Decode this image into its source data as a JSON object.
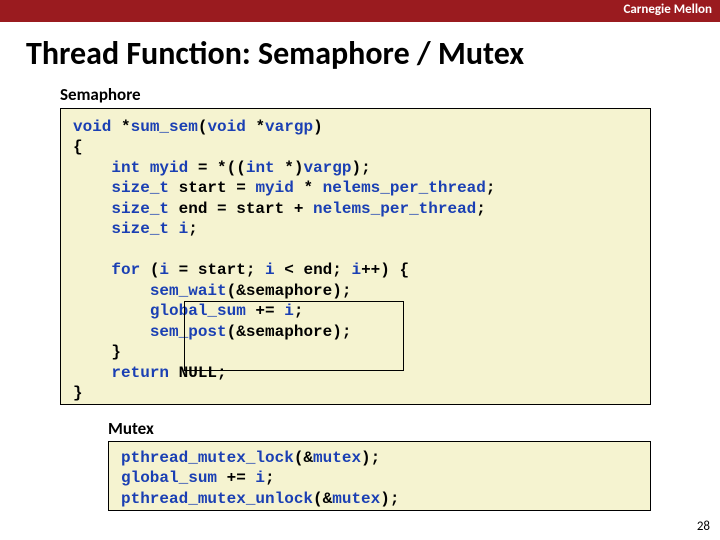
{
  "brand": "Carnegie Mellon",
  "title": "Thread Function: Semaphore / Mutex",
  "sem_label": "Semaphore",
  "mutex_label": "Mutex",
  "page_number": "28",
  "code1": {
    "l1a": "void",
    "l1b": " *",
    "l1c": "sum_sem",
    "l1d": "(",
    "l1e": "void",
    "l1f": " *",
    "l1g": "vargp",
    "l1h": ")",
    "l2": "{",
    "l3a": "    ",
    "l3b": "int",
    "l3c": " ",
    "l3d": "myid",
    "l3e": " = *((",
    "l3f": "int",
    "l3g": " *)",
    "l3h": "vargp",
    "l3i": ");",
    "l4a": "    ",
    "l4b": "size_t",
    "l4c": " start = ",
    "l4d": "myid",
    "l4e": " * ",
    "l4f": "nelems_per_thread",
    "l4g": ";",
    "l5a": "    ",
    "l5b": "size_t",
    "l5c": " end = start + ",
    "l5d": "nelems_per_thread",
    "l5e": ";",
    "l6a": "    ",
    "l6b": "size_t",
    "l6c": " ",
    "l6d": "i",
    "l6e": ";",
    "blank1": " ",
    "l7a": "    ",
    "l7b": "for",
    "l7c": " (",
    "l7d": "i",
    "l7e": " = start; ",
    "l7f": "i",
    "l7g": " < end; ",
    "l7h": "i",
    "l7i": "++) {",
    "l8a": "        ",
    "l8b": "sem_wait",
    "l8c": "(&semaphore);",
    "l9a": "        ",
    "l9b": "global_sum",
    "l9c": " += ",
    "l9d": "i",
    "l9e": ";",
    "l10a": "        ",
    "l10b": "sem_post",
    "l10c": "(&semaphore);",
    "l11": "    }",
    "l12a": "    ",
    "l12b": "return",
    "l12c": " NULL;",
    "l13": "}"
  },
  "code2": {
    "l1a": "pthread_mutex_lock",
    "l1b": "(&",
    "l1c": "mutex",
    "l1d": ");",
    "l2a": "global_sum",
    "l2b": " += ",
    "l2c": "i",
    "l2d": ";",
    "l3a": "pthread_mutex_unlock",
    "l3b": "(&",
    "l3c": "mutex",
    "l3d": ");"
  }
}
